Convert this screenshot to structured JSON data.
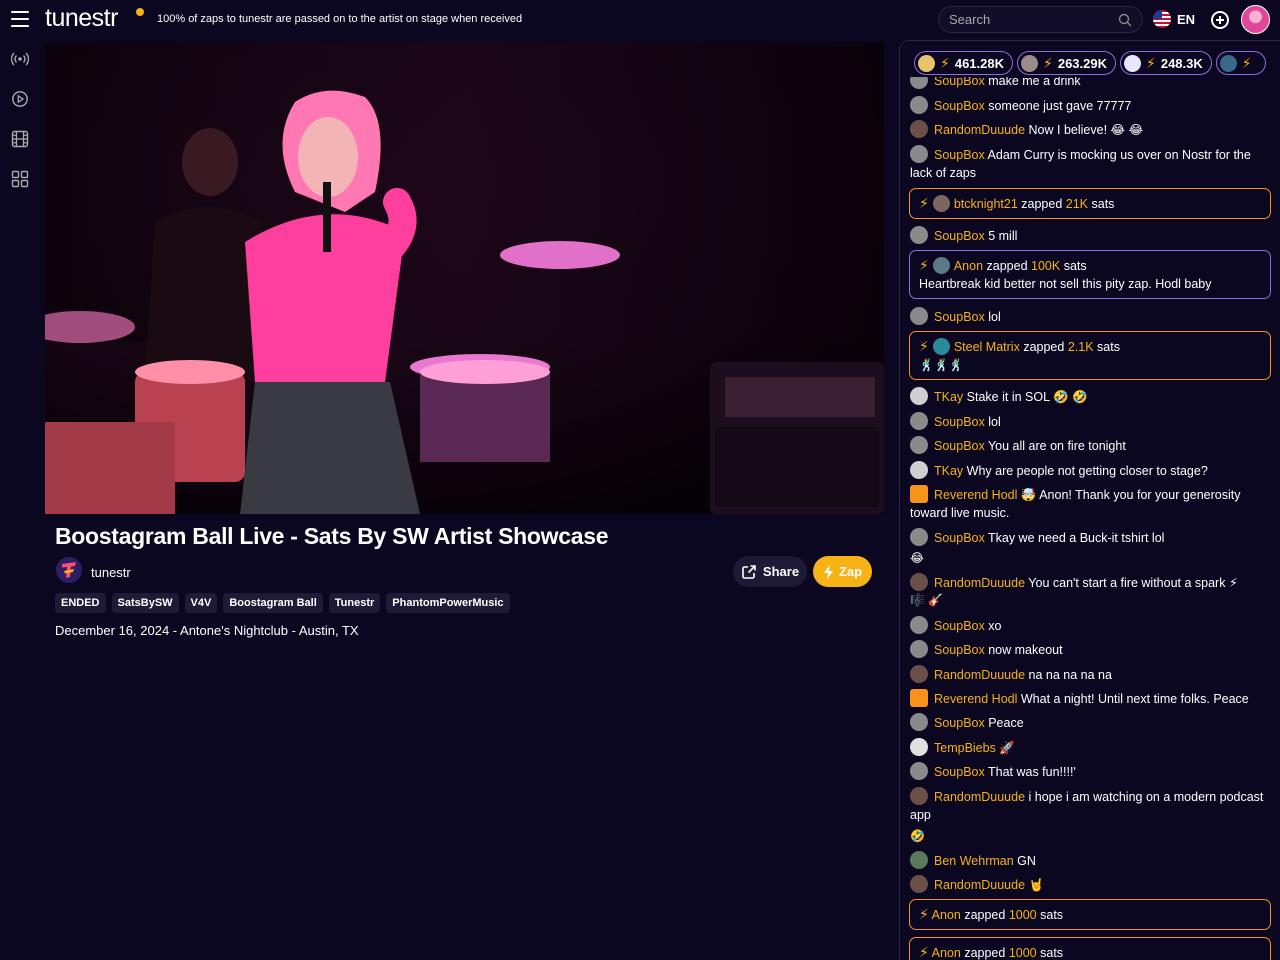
{
  "app": {
    "logo": "tunestr",
    "tagline": "100% of zaps to tunestr are passed on to the artist on stage when received",
    "search_placeholder": "Search",
    "language": "EN"
  },
  "rail": {
    "icons": [
      "live-icon",
      "play-icon",
      "film-icon",
      "grid-icon"
    ]
  },
  "stream": {
    "title": "Boostagram Ball Live - Sats By SW Artist Showcase",
    "channel": "tunestr",
    "share_label": "Share",
    "zap_label": "Zap",
    "tags": [
      "ENDED",
      "SatsBySW",
      "V4V",
      "Boostagram Ball",
      "Tunestr",
      "PhantomPowerMusic"
    ],
    "date": "December 16, 2024 - Antone's Nightclub - Austin, TX"
  },
  "leaderboard": [
    {
      "amount": "461.28K",
      "color": "#e8c36a"
    },
    {
      "amount": "263.29K",
      "color": "#9a8a8a"
    },
    {
      "amount": "248.3K",
      "color": "#e6e6ff"
    },
    {
      "amount": "",
      "color": "#3a6a8a"
    }
  ],
  "chat": {
    "messages": [
      {
        "user": "SoupBox",
        "text": "make me a drink"
      },
      {
        "user": "SoupBox",
        "text": "someone just gave 77777"
      },
      {
        "user": "RandomDuuude",
        "text": "Now I believe! 😂 😂"
      },
      {
        "user": "SoupBox",
        "text": "Adam Curry is mocking us over on Nostr for the lack of zaps"
      },
      {
        "user": "btcknight21",
        "action": "zapped",
        "amount": "21K",
        "unit": "sats"
      },
      {
        "user": "SoupBox",
        "text": "5 mill"
      },
      {
        "user": "Anon",
        "action": "zapped",
        "amount": "100K",
        "unit": "sats",
        "note": "Heartbreak kid better not sell this pity zap. Hodl baby"
      },
      {
        "user": "SoupBox",
        "text": "lol"
      },
      {
        "user": "Steel Matrix",
        "action": "zapped",
        "amount": "2.1K",
        "unit": "sats",
        "note": "🕺🕺🕺"
      },
      {
        "user": "TKay",
        "text": "Stake it in SOL 🤣 🤣"
      },
      {
        "user": "SoupBox",
        "text": "lol"
      },
      {
        "user": "SoupBox",
        "text": "You all are on fire tonight"
      },
      {
        "user": "TKay",
        "text": "Why are people not getting closer to stage?"
      },
      {
        "user": "Reverend Hodl",
        "text": "🤯 Anon! Thank you for your generosity toward live music."
      },
      {
        "user": "SoupBox",
        "text": "Tkay we need a Buck-it tshirt lol"
      },
      {
        "user": "",
        "text": "😂"
      },
      {
        "user": "RandomDuuude",
        "text": "You can't start a fire without a spark ⚡"
      },
      {
        "user": "",
        "text": "🎼 🎸"
      },
      {
        "user": "SoupBox",
        "text": "xo"
      },
      {
        "user": "SoupBox",
        "text": "now makeout"
      },
      {
        "user": "RandomDuuude",
        "text": "na na na na na"
      },
      {
        "user": "Reverend Hodl",
        "text": "What a night! Until next time folks. Peace"
      },
      {
        "user": "SoupBox",
        "text": "Peace"
      },
      {
        "user": "TempBiebs",
        "text": "🚀"
      },
      {
        "user": "SoupBox",
        "text": "That was fun!!!!'"
      },
      {
        "user": "RandomDuuude",
        "text": "i hope i am watching on a modern podcast app"
      },
      {
        "user": "",
        "text": "🤣"
      },
      {
        "user": "Ben Wehrman",
        "text": "GN"
      },
      {
        "user": "RandomDuuude",
        "text": "🤘"
      },
      {
        "user": "Anon",
        "action": "zapped",
        "amount": "1000",
        "unit": "sats"
      },
      {
        "user": "Anon",
        "action": "zapped",
        "amount": "1000",
        "unit": "sats"
      }
    ]
  }
}
